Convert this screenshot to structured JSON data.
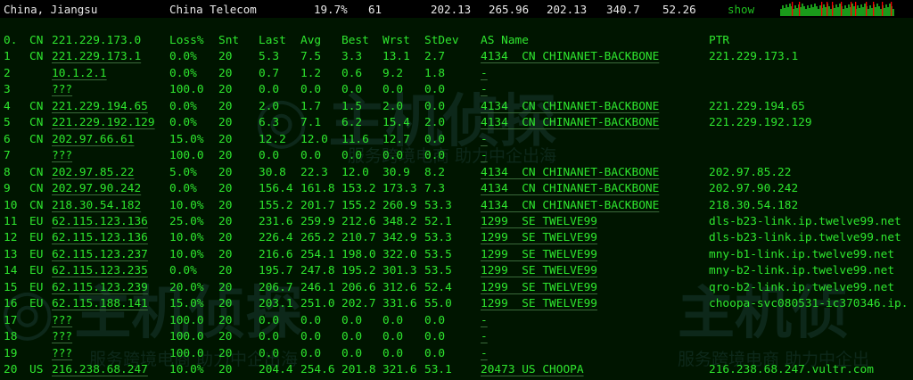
{
  "summary": {
    "location": "China, Jiangsu",
    "isp": "China Telecom",
    "loss": "19.7%",
    "sent": "61",
    "last": "202.13",
    "avg": "265.96",
    "best": "202.13",
    "worst": "340.7",
    "stdev": "52.26",
    "show_label": "show",
    "graph_color_ok": "#1a9a1a",
    "graph_color_loss": "#ff0000"
  },
  "table": {
    "headers": {
      "idx": "0.",
      "cc": "CN",
      "host": "221.229.173.0",
      "loss": "Loss%",
      "snt": "Snt",
      "last": "Last",
      "avg": "Avg",
      "best": "Best",
      "wrst": "Wrst",
      "stdev": "StDev",
      "as": "AS Name",
      "ptr": "PTR"
    },
    "rows": [
      {
        "idx": "1",
        "cc": "CN",
        "host": "221.229.173.1",
        "loss": "0.0%",
        "snt": "20",
        "last": "5.3",
        "avg": "7.5",
        "best": "3.3",
        "wrst": "13.1",
        "stdev": "2.7",
        "as": "4134  CN CHINANET-BACKBONE",
        "ptr": "221.229.173.1"
      },
      {
        "idx": "2",
        "cc": "",
        "host": "10.1.2.1",
        "loss": "0.0%",
        "snt": "20",
        "last": "0.7",
        "avg": "1.2",
        "best": "0.6",
        "wrst": "9.2",
        "stdev": "1.8",
        "as": "-",
        "ptr": ""
      },
      {
        "idx": "3",
        "cc": "",
        "host": "???",
        "loss": "100.0",
        "snt": "20",
        "last": "0.0",
        "avg": "0.0",
        "best": "0.0",
        "wrst": "0.0",
        "stdev": "0.0",
        "as": "-",
        "ptr": ""
      },
      {
        "idx": "4",
        "cc": "CN",
        "host": "221.229.194.65",
        "loss": "0.0%",
        "snt": "20",
        "last": "2.0",
        "avg": "1.7",
        "best": "1.5",
        "wrst": "2.0",
        "stdev": "0.0",
        "as": "4134  CN CHINANET-BACKBONE",
        "ptr": "221.229.194.65"
      },
      {
        "idx": "5",
        "cc": "CN",
        "host": "221.229.192.129",
        "loss": "0.0%",
        "snt": "20",
        "last": "6.3",
        "avg": "7.1",
        "best": "6.2",
        "wrst": "15.4",
        "stdev": "2.0",
        "as": "4134  CN CHINANET-BACKBONE",
        "ptr": "221.229.192.129"
      },
      {
        "idx": "6",
        "cc": "CN",
        "host": "202.97.66.61",
        "loss": "15.0%",
        "snt": "20",
        "last": "12.2",
        "avg": "12.0",
        "best": "11.6",
        "wrst": "12.7",
        "stdev": "0.0",
        "as": "-",
        "ptr": ""
      },
      {
        "idx": "7",
        "cc": "",
        "host": "???",
        "loss": "100.0",
        "snt": "20",
        "last": "0.0",
        "avg": "0.0",
        "best": "0.0",
        "wrst": "0.0",
        "stdev": "0.0",
        "as": "-",
        "ptr": ""
      },
      {
        "idx": "8",
        "cc": "CN",
        "host": "202.97.85.22",
        "loss": "5.0%",
        "snt": "20",
        "last": "30.8",
        "avg": "22.3",
        "best": "12.0",
        "wrst": "30.9",
        "stdev": "8.2",
        "as": "4134  CN CHINANET-BACKBONE",
        "ptr": "202.97.85.22"
      },
      {
        "idx": "9",
        "cc": "CN",
        "host": "202.97.90.242",
        "loss": "0.0%",
        "snt": "20",
        "last": "156.4",
        "avg": "161.8",
        "best": "153.2",
        "wrst": "173.3",
        "stdev": "7.3",
        "as": "4134  CN CHINANET-BACKBONE",
        "ptr": "202.97.90.242"
      },
      {
        "idx": "10",
        "cc": "CN",
        "host": "218.30.54.182",
        "loss": "10.0%",
        "snt": "20",
        "last": "155.2",
        "avg": "201.7",
        "best": "155.2",
        "wrst": "260.9",
        "stdev": "53.3",
        "as": "4134  CN CHINANET-BACKBONE",
        "ptr": "218.30.54.182"
      },
      {
        "idx": "11",
        "cc": "EU",
        "host": "62.115.123.136",
        "loss": "25.0%",
        "snt": "20",
        "last": "231.6",
        "avg": "259.9",
        "best": "212.6",
        "wrst": "348.2",
        "stdev": "52.1",
        "as": "1299  SE TWELVE99",
        "ptr": "dls-b23-link.ip.twelve99.net"
      },
      {
        "idx": "12",
        "cc": "EU",
        "host": "62.115.123.136",
        "loss": "10.0%",
        "snt": "20",
        "last": "226.4",
        "avg": "265.2",
        "best": "210.7",
        "wrst": "342.9",
        "stdev": "53.3",
        "as": "1299  SE TWELVE99",
        "ptr": "dls-b23-link.ip.twelve99.net"
      },
      {
        "idx": "13",
        "cc": "EU",
        "host": "62.115.123.237",
        "loss": "10.0%",
        "snt": "20",
        "last": "216.6",
        "avg": "254.1",
        "best": "198.0",
        "wrst": "322.0",
        "stdev": "53.5",
        "as": "1299  SE TWELVE99",
        "ptr": "mny-b1-link.ip.twelve99.net"
      },
      {
        "idx": "14",
        "cc": "EU",
        "host": "62.115.123.235",
        "loss": "0.0%",
        "snt": "20",
        "last": "195.7",
        "avg": "247.8",
        "best": "195.2",
        "wrst": "301.3",
        "stdev": "53.5",
        "as": "1299  SE TWELVE99",
        "ptr": "mny-b2-link.ip.twelve99.net"
      },
      {
        "idx": "15",
        "cc": "EU",
        "host": "62.115.123.239",
        "loss": "20.0%",
        "snt": "20",
        "last": "206.7",
        "avg": "246.1",
        "best": "206.6",
        "wrst": "312.6",
        "stdev": "52.4",
        "as": "1299  SE TWELVE99",
        "ptr": "qro-b2-link.ip.twelve99.net"
      },
      {
        "idx": "16",
        "cc": "EU",
        "host": "62.115.188.141",
        "loss": "15.0%",
        "snt": "20",
        "last": "203.1",
        "avg": "251.0",
        "best": "202.7",
        "wrst": "331.6",
        "stdev": "55.0",
        "as": "1299  SE TWELVE99",
        "ptr": "choopa-svc080531-ic370346.ip."
      },
      {
        "idx": "17",
        "cc": "",
        "host": "???",
        "loss": "100.0",
        "snt": "20",
        "last": "0.0",
        "avg": "0.0",
        "best": "0.0",
        "wrst": "0.0",
        "stdev": "0.0",
        "as": "-",
        "ptr": ""
      },
      {
        "idx": "18",
        "cc": "",
        "host": "???",
        "loss": "100.0",
        "snt": "20",
        "last": "0.0",
        "avg": "0.0",
        "best": "0.0",
        "wrst": "0.0",
        "stdev": "0.0",
        "as": "-",
        "ptr": ""
      },
      {
        "idx": "19",
        "cc": "",
        "host": "???",
        "loss": "100.0",
        "snt": "20",
        "last": "0.0",
        "avg": "0.0",
        "best": "0.0",
        "wrst": "0.0",
        "stdev": "0.0",
        "as": "-",
        "ptr": ""
      },
      {
        "idx": "20",
        "cc": "US",
        "host": "216.238.68.247",
        "loss": "10.0%",
        "snt": "20",
        "last": "204.4",
        "avg": "254.6",
        "best": "201.8",
        "wrst": "321.6",
        "stdev": "53.1",
        "as": "20473 US CHOOPA",
        "ptr": "216.238.68.247.vultr.com"
      }
    ]
  },
  "watermark": {
    "brand": "主机侦探",
    "slogan": "服务跨境电商 助力中企出海"
  }
}
